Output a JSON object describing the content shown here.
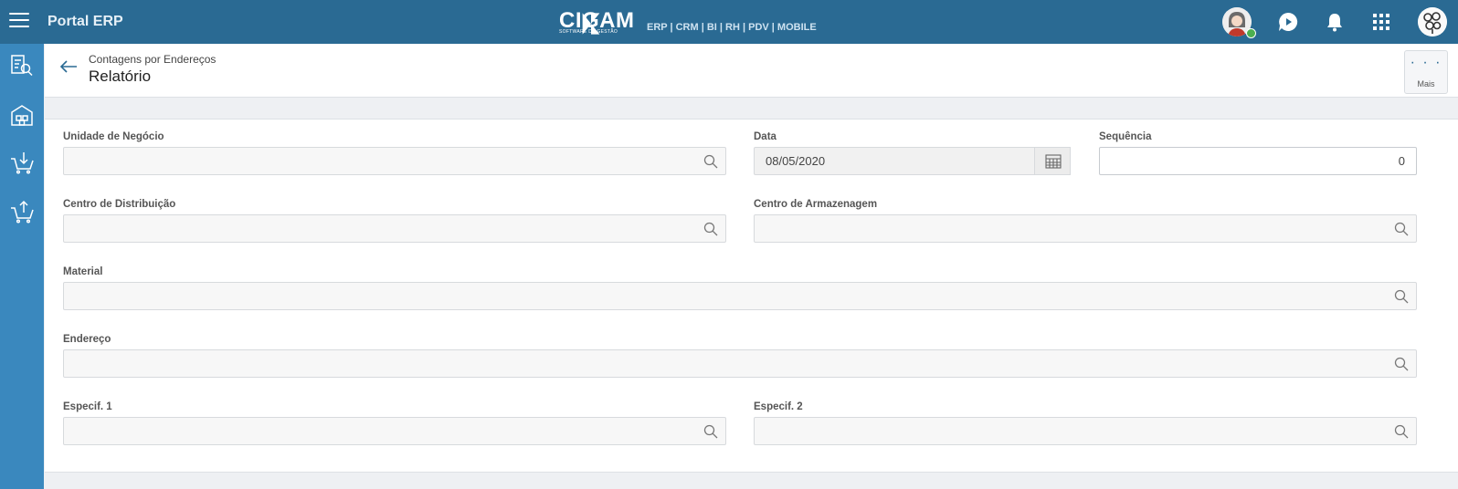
{
  "topbar": {
    "app_title": "Portal ERP",
    "brand_name": "CIGAM",
    "brand_tagline": "SOFTWARE DE GESTÃO",
    "brand_modules": "ERP | CRM | BI | RH | PDV | MOBILE",
    "icons": [
      "menu-icon",
      "chat-play-icon",
      "bell-icon",
      "apps-grid-icon",
      "user-avatar",
      "company-avatar"
    ]
  },
  "sidebar": {
    "items": [
      "report-search-icon",
      "warehouse-icon",
      "basket-in-icon",
      "basket-out-icon"
    ]
  },
  "header": {
    "breadcrumb": "Contagens por Endereços",
    "title": "Relatório",
    "more_label": "Mais",
    "more_dots": "· · ·"
  },
  "form": {
    "unidade_label": "Unidade de Negócio",
    "unidade_value": "",
    "data_label": "Data",
    "data_value": "08/05/2020",
    "sequencia_label": "Sequência",
    "sequencia_value": "0",
    "centro_dist_label": "Centro de Distribuição",
    "centro_dist_value": "",
    "centro_arm_label": "Centro de Armazenagem",
    "centro_arm_value": "",
    "material_label": "Material",
    "material_value": "",
    "endereco_label": "Endereço",
    "endereco_value": "",
    "especif1_label": "Especif. 1",
    "especif1_value": "",
    "especif2_label": "Especif. 2",
    "especif2_value": ""
  },
  "colors": {
    "topbar": "#2a6a93",
    "sidebar": "#3a88be",
    "accent": "#2a6a93",
    "online": "#4caf50"
  }
}
